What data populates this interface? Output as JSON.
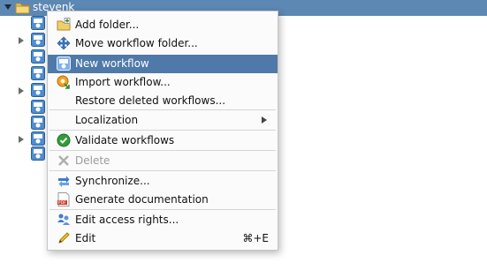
{
  "tree": {
    "root_label": "stevenk",
    "rows": [
      {
        "has_arrow": false
      },
      {
        "has_arrow": true
      },
      {
        "has_arrow": false
      },
      {
        "has_arrow": false
      },
      {
        "has_arrow": true
      },
      {
        "has_arrow": false
      },
      {
        "has_arrow": false
      },
      {
        "has_arrow": true
      },
      {
        "has_arrow": false
      }
    ]
  },
  "context_menu": {
    "items": [
      {
        "label": "Add folder...",
        "icon": "add-folder-icon"
      },
      {
        "label": "Move workflow folder...",
        "icon": "move-icon"
      },
      {
        "label": "New workflow",
        "icon": "new-workflow-icon",
        "selected": true
      },
      {
        "label": "Import workflow...",
        "icon": "import-workflow-icon"
      },
      {
        "label": "Restore deleted workflows...",
        "icon": ""
      },
      {
        "label": "Localization",
        "icon": "",
        "submenu": true
      },
      {
        "label": "Validate workflows",
        "icon": "validate-check-icon"
      },
      {
        "label": "Delete",
        "icon": "delete-x-icon",
        "disabled": true
      },
      {
        "label": "Synchronize...",
        "icon": "synchronize-icon"
      },
      {
        "label": "Generate documentation",
        "icon": "pdf-icon"
      },
      {
        "label": "Edit access rights...",
        "icon": "users-icon"
      },
      {
        "label": "Edit",
        "icon": "pencil-icon",
        "shortcut": "⌘+E"
      }
    ]
  },
  "colors": {
    "header_bg": "#5d88b4",
    "selection_bg": "#4f79a8"
  }
}
